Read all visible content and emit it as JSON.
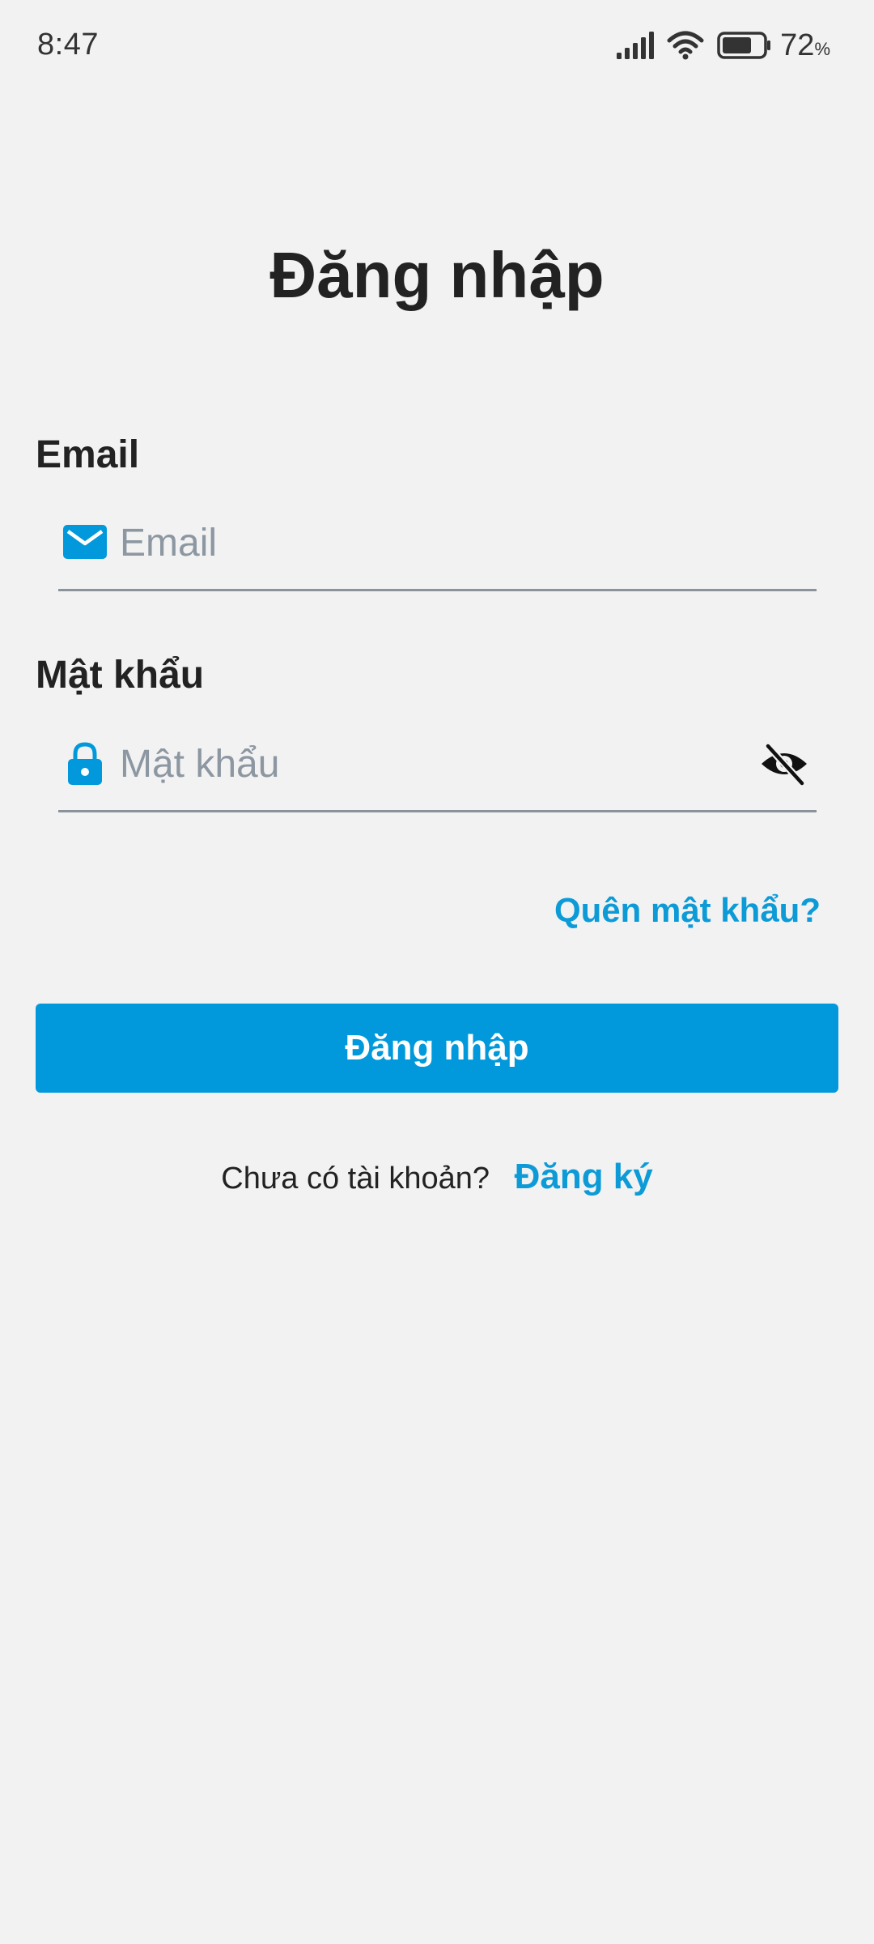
{
  "status_bar": {
    "time": "8:47",
    "battery_percent": "72",
    "battery_unit": "%",
    "icons": [
      "signal-icon",
      "wifi-icon",
      "battery-icon"
    ]
  },
  "page": {
    "title": "Đăng nhập"
  },
  "email_field": {
    "label": "Email",
    "placeholder": "Email",
    "value": "",
    "icon": "mail-icon"
  },
  "password_field": {
    "label": "Mật khẩu",
    "placeholder": "Mật khẩu",
    "value": "",
    "icon": "lock-icon",
    "toggle_icon": "eye-off-icon"
  },
  "forgot_password": {
    "label": "Quên mật khẩu?"
  },
  "login_button": {
    "label": "Đăng nhập"
  },
  "signup": {
    "prompt": "Chưa có tài khoản?",
    "link_label": "Đăng ký"
  },
  "colors": {
    "background": "#f2f2f2",
    "primary": "#0199db",
    "link": "#0d9bd7",
    "underline": "#8a939c",
    "placeholder": "#8d97a2"
  }
}
